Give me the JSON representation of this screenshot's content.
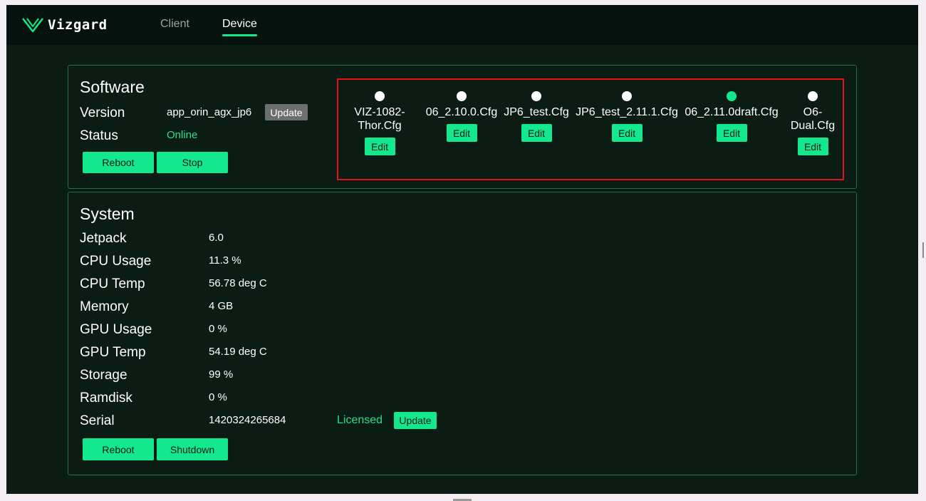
{
  "app": {
    "name": "Vizgard",
    "nav": [
      {
        "label": "Client",
        "active": false
      },
      {
        "label": "Device",
        "active": true
      }
    ]
  },
  "colors": {
    "accent": "#14e88f",
    "background": "#0b1c15",
    "highlight_box": "#e0141a"
  },
  "software": {
    "title": "Software",
    "version_label": "Version",
    "version_value": "app_orin_agx_jp6",
    "version_update_label": "Update",
    "status_label": "Status",
    "status_value": "Online",
    "reboot_label": "Reboot",
    "stop_label": "Stop",
    "configs": [
      {
        "name_lines": [
          "VIZ-1082-",
          "Thor.Cfg"
        ],
        "selected": false,
        "edit_label": "Edit"
      },
      {
        "name_lines": [
          "06_2.10.0.Cfg"
        ],
        "selected": false,
        "edit_label": "Edit"
      },
      {
        "name_lines": [
          "JP6_test.Cfg"
        ],
        "selected": false,
        "edit_label": "Edit"
      },
      {
        "name_lines": [
          "JP6_test_2.11.1.Cfg"
        ],
        "selected": false,
        "edit_label": "Edit"
      },
      {
        "name_lines": [
          "06_2.11.0draft.Cfg"
        ],
        "selected": true,
        "edit_label": "Edit"
      },
      {
        "name_lines": [
          "O6-",
          "Dual.Cfg"
        ],
        "selected": false,
        "edit_label": "Edit"
      }
    ]
  },
  "system": {
    "title": "System",
    "rows": [
      {
        "label": "Jetpack",
        "value": "6.0"
      },
      {
        "label": "CPU Usage",
        "value": "11.3 %"
      },
      {
        "label": "CPU Temp",
        "value": "56.78 deg C"
      },
      {
        "label": "Memory",
        "value": "4 GB"
      },
      {
        "label": "GPU Usage",
        "value": "0 %"
      },
      {
        "label": "GPU Temp",
        "value": "54.19 deg C"
      },
      {
        "label": "Storage",
        "value": "99 %"
      },
      {
        "label": "Ramdisk",
        "value": "0 %"
      },
      {
        "label": "Serial",
        "value": "1420324265684"
      }
    ],
    "license_status": "Licensed",
    "license_update_label": "Update",
    "reboot_label": "Reboot",
    "shutdown_label": "Shutdown"
  }
}
